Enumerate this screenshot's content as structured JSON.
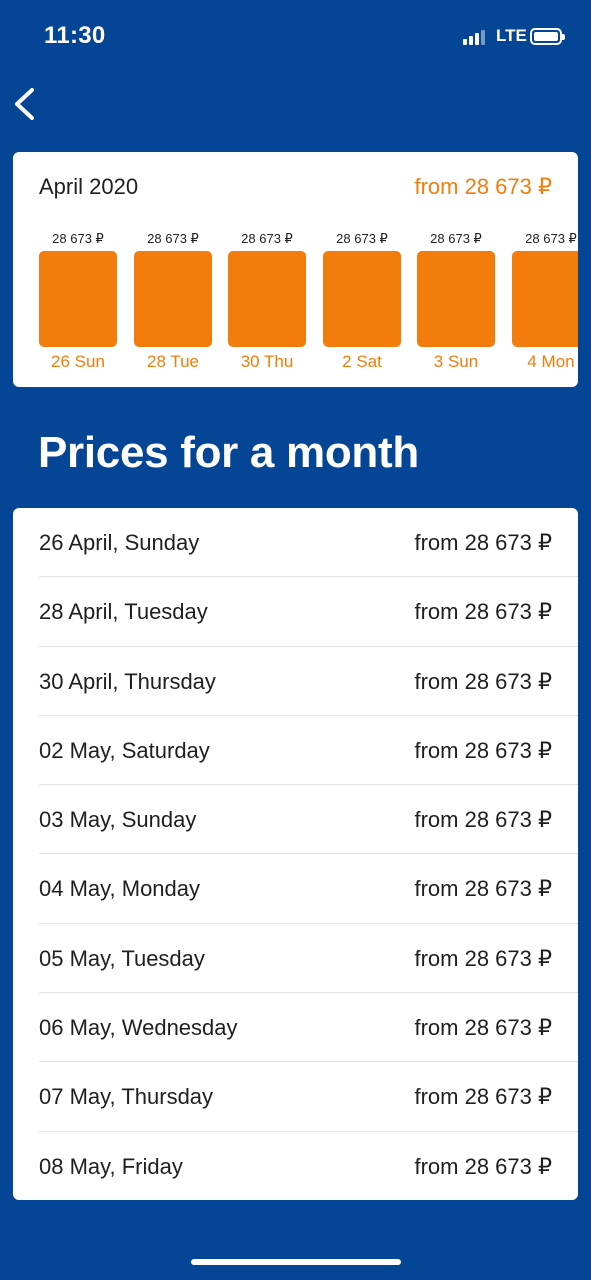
{
  "status_bar": {
    "time": "11:30",
    "network": "LTE"
  },
  "header": {
    "back_icon": "chevron-left-icon"
  },
  "month_card": {
    "month": "April 2020",
    "price": "from 28 673 ₽",
    "days": [
      {
        "price": "28 673 ₽",
        "label": "26 Sun"
      },
      {
        "price": "28 673 ₽",
        "label": "28 Tue"
      },
      {
        "price": "28 673 ₽",
        "label": "30 Thu"
      },
      {
        "price": "28 673 ₽",
        "label": "2 Sat"
      },
      {
        "price": "28 673 ₽",
        "label": "3 Sun"
      },
      {
        "price": "28 673 ₽",
        "label": "4 Mon"
      }
    ]
  },
  "section_title": "Prices for a month",
  "price_list": [
    {
      "date": "26 April, Sunday",
      "price": "from 28 673 ₽"
    },
    {
      "date": "28 April, Tuesday",
      "price": "from 28 673 ₽"
    },
    {
      "date": "30 April, Thursday",
      "price": "from 28 673 ₽"
    },
    {
      "date": "02 May, Saturday",
      "price": "from 28 673 ₽"
    },
    {
      "date": "03 May, Sunday",
      "price": "from 28 673 ₽"
    },
    {
      "date": "04 May, Monday",
      "price": "from 28 673 ₽"
    },
    {
      "date": "05 May, Tuesday",
      "price": "from 28 673 ₽"
    },
    {
      "date": "06 May, Wednesday",
      "price": "from 28 673 ₽"
    },
    {
      "date": "07 May, Thursday",
      "price": "from 28 673 ₽"
    },
    {
      "date": "08 May, Friday",
      "price": "from 28 673 ₽"
    }
  ],
  "colors": {
    "background": "#044595",
    "accent": "#f27d0c",
    "card": "#ffffff"
  }
}
